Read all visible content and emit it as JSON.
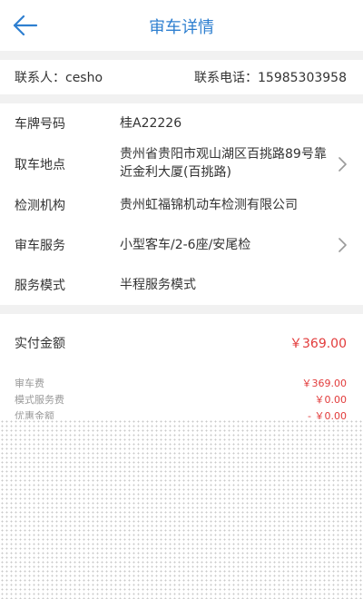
{
  "header": {
    "title": "审车详情"
  },
  "contact": {
    "name_text": "联系人：cesho",
    "phone_text": "联系电话：15985303958"
  },
  "details": [
    {
      "label": "车牌号码",
      "value": "桂A22226"
    },
    {
      "label": "取车地点",
      "value": "贵州省贵阳市观山湖区百挑路89号靠近金利大厦(百挑路)"
    },
    {
      "label": "检测机构",
      "value": "贵州虹福锦机动车检测有限公司"
    },
    {
      "label": "审车服务",
      "value": "小型客车/2-6座/安尾检"
    },
    {
      "label": "服务模式",
      "value": "半程服务模式"
    }
  ],
  "payment": {
    "label": "实付金额",
    "value": "￥369.00"
  },
  "fees": [
    {
      "label": "审车费",
      "value": "￥369.00"
    },
    {
      "label": "模式服务费",
      "value": "￥0.00"
    },
    {
      "label": "优惠金额",
      "value": "- ￥0.00"
    }
  ],
  "colors": {
    "accent": "#2e7fd0",
    "price": "#e23b3b"
  },
  "icons": {
    "back": "arrow-left-icon",
    "chevron": "chevron-right-icon"
  }
}
